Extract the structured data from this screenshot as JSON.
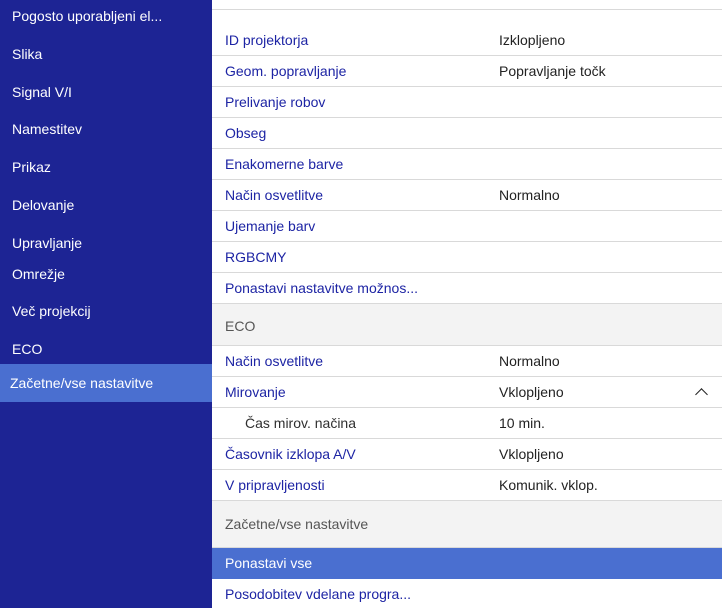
{
  "colors": {
    "sidebar_bg": "#1d2494",
    "selected_bg": "#4a6fd0",
    "label_text": "#1d24a4"
  },
  "sidebar": {
    "items": [
      {
        "label": "Pogosto uporabljeni el..."
      },
      {
        "label": "Slika"
      },
      {
        "label": "Signal V/I"
      },
      {
        "label": "Namestitev"
      },
      {
        "label": "Prikaz"
      },
      {
        "label": "Delovanje"
      },
      {
        "label": "Upravljanje"
      },
      {
        "label": "Omrežje"
      },
      {
        "label": "Več projekcij"
      },
      {
        "label": "ECO"
      },
      {
        "label": "Začetne/vse nastavitve"
      }
    ]
  },
  "main": {
    "rows": [
      {
        "label": "ID projektorja",
        "value": "Izklopljeno"
      },
      {
        "label": "Geom. popravljanje",
        "value": "Popravljanje točk"
      },
      {
        "label": "Prelivanje robov",
        "value": ""
      },
      {
        "label": "Obseg",
        "value": ""
      },
      {
        "label": "Enakomerne barve",
        "value": ""
      },
      {
        "label": "Način osvetlitve",
        "value": "Normalno"
      },
      {
        "label": "Ujemanje barv",
        "value": ""
      },
      {
        "label": "RGBCMY",
        "value": ""
      },
      {
        "label": "Ponastavi nastavitve možnos...",
        "value": ""
      },
      {
        "label": "ECO",
        "value": ""
      },
      {
        "label": "Način osvetlitve",
        "value": "Normalno"
      },
      {
        "label": "Mirovanje",
        "value": "Vklopljeno"
      },
      {
        "label": "Čas mirov. načina",
        "value": "10 min."
      },
      {
        "label": "Časovnik izklopa A/V",
        "value": "Vklopljeno"
      },
      {
        "label": "V pripravljenosti",
        "value": "Komunik. vklop."
      },
      {
        "label": "Začetne/vse nastavitve",
        "value": ""
      },
      {
        "label": "Ponastavi vse",
        "value": ""
      },
      {
        "label": "Posodobitev vdelane progra...",
        "value": ""
      }
    ],
    "chevron_icon": "chevron-up-icon"
  }
}
